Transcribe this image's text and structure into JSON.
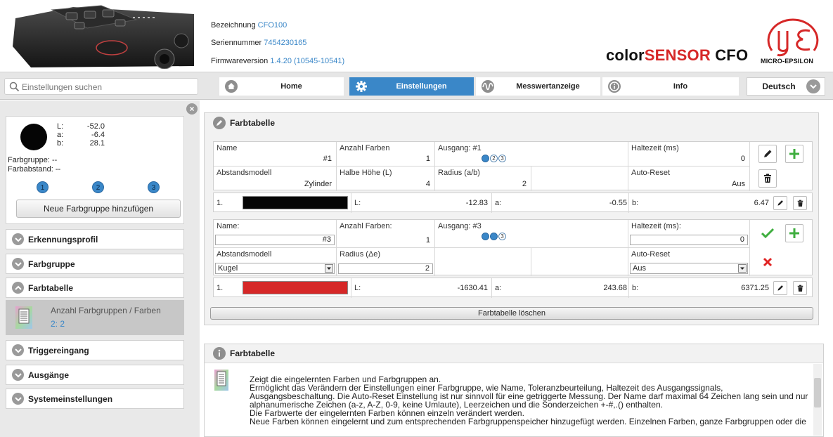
{
  "header": {
    "device_info": [
      {
        "label": "Bezeichnung",
        "value": "CFO100"
      },
      {
        "label": "Seriennummer",
        "value": "7454230165"
      },
      {
        "label": "Firmwareversion",
        "value": "1.4.20 (10545-10541)"
      }
    ],
    "brand_prefix": "color",
    "brand_highlight": "SENSOR",
    "brand_suffix": " CFO",
    "logo_text": "MICRO-EPSILON"
  },
  "navbar": {
    "search_placeholder": "Einstellungen suchen",
    "tabs": [
      {
        "label": "Home",
        "icon": "home-icon"
      },
      {
        "label": "Einstellungen",
        "icon": "gear-icon",
        "active": true
      },
      {
        "label": "Messwertanzeige",
        "icon": "waveform-icon"
      },
      {
        "label": "Info",
        "icon": "info-icon"
      }
    ],
    "language": "Deutsch"
  },
  "sidebar": {
    "lab": [
      {
        "label": "L:",
        "value": "-52.0"
      },
      {
        "label": "a:",
        "value": "-6.4"
      },
      {
        "label": "b:",
        "value": "28.1"
      }
    ],
    "farbgruppe": "Farbgruppe: --",
    "farbabstand": "Farbabstand: --",
    "outputs": [
      "1",
      "2",
      "3"
    ],
    "new_group_label": "Neue Farbgruppe hinzufügen",
    "items": [
      {
        "label": "Erkennungsprofil",
        "expanded": false
      },
      {
        "label": "Farbgruppe",
        "expanded": false
      },
      {
        "label": "Farbtabelle",
        "expanded": true
      },
      {
        "label": "Triggereingang",
        "expanded": false
      },
      {
        "label": "Ausgänge",
        "expanded": false
      },
      {
        "label": "Systemeinstellungen",
        "expanded": false
      }
    ],
    "sub_item": {
      "label": "Anzahl Farbgruppen / Farben",
      "value": "2: 2"
    }
  },
  "main": {
    "title": "Farbtabelle",
    "group1": {
      "name_label": "Name",
      "name_value": "#1",
      "count_label": "Anzahl Farben",
      "count_value": "1",
      "output_label": "Ausgang: #1",
      "hold_label": "Haltezeit (ms)",
      "hold_value": "0",
      "model_label": "Abstandsmodell",
      "model_value": "Zylinder",
      "half_label": "Halbe Höhe (L)",
      "half_value": "4",
      "radius_label": "Radius (a/b)",
      "radius_value": "2",
      "reset_label": "Auto-Reset",
      "reset_value": "Aus",
      "color_row": {
        "index": "1.",
        "swatch": "#050505",
        "L_label": "L:",
        "L": "-12.83",
        "a_label": "a:",
        "a": "-0.55",
        "b_label": "b:",
        "b": "6.47"
      }
    },
    "group2": {
      "name_label": "Name:",
      "name_value": "#3",
      "count_label": "Anzahl Farben:",
      "count_value": "1",
      "output_label": "Ausgang: #3",
      "hold_label": "Haltezeit (ms):",
      "hold_value": "0",
      "model_label": "Abstandsmodell",
      "model_value": "Kugel",
      "radius_label": "Radius (Δe)",
      "radius_value": "2",
      "reset_label": "Auto-Reset",
      "reset_value": "Aus",
      "color_row": {
        "index": "1.",
        "swatch": "#d62828",
        "L_label": "L:",
        "L": "-1630.41",
        "a_label": "a:",
        "a": "243.68",
        "b_label": "b:",
        "b": "6371.25"
      }
    },
    "clear_label": "Farbtabelle löschen"
  },
  "help": {
    "title": "Farbtabelle",
    "lines": [
      "Zeigt die eingelernten Farben und Farbgruppen an.",
      "Ermöglicht das Verändern der Einstellungen einer Farbgruppe, wie Name, Toleranzbeurteilung, Haltezeit des Ausgangssignals,",
      "Ausgangsbeschaltung. Die Auto-Reset Einstellung ist nur sinnvoll für eine getriggerte Messung. Der Name darf maximal 64 Zeichen lang sein und nur",
      "alphanumerische Zeichen (a-z, A-Z, 0-9, keine Umlaute), Leerzeichen und die Sonderzeichen +-#,.() enthalten.",
      "Die Farbwerte der eingelernten Farben können einzeln verändert werden.",
      "Neue Farben können eingelernt und zum entsprechenden Farbgruppenspeicher hinzugefügt werden. Einzelnen Farben, ganze Farbgruppen oder die"
    ]
  },
  "colors": {
    "accent": "#3a87c8",
    "brand_red": "#d62828",
    "success": "#3fae3f"
  }
}
